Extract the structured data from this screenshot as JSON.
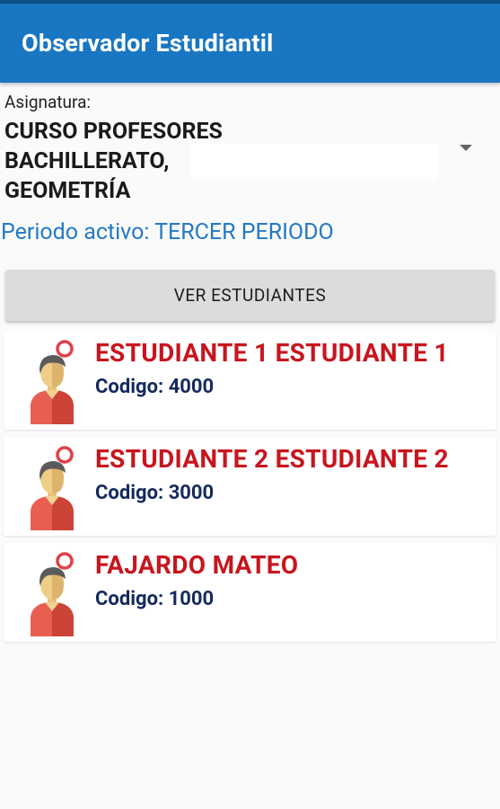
{
  "app": {
    "title": "Observador Estudiantil"
  },
  "subject": {
    "label": "Asignatura:",
    "value_lines": [
      "CURSO PROFESORES",
      "BACHILLERATO,",
      "GEOMETRÍA"
    ]
  },
  "period": {
    "text": "Periodo activo: TERCER PERIODO"
  },
  "actions": {
    "view_students_label": "VER ESTUDIANTES"
  },
  "students": [
    {
      "name": "ESTUDIANTE 1 ESTUDIANTE 1",
      "code_label": "Codigo:",
      "code": "4000"
    },
    {
      "name": "ESTUDIANTE 2 ESTUDIANTE 2",
      "code_label": "Codigo:",
      "code": "3000"
    },
    {
      "name": "FAJARDO MATEO",
      "code_label": "Codigo:",
      "code": "1000"
    }
  ],
  "colors": {
    "appbar": "#1976c2",
    "period_text": "#2379c5",
    "student_name": "#c8151e",
    "student_code": "#152a5e"
  }
}
